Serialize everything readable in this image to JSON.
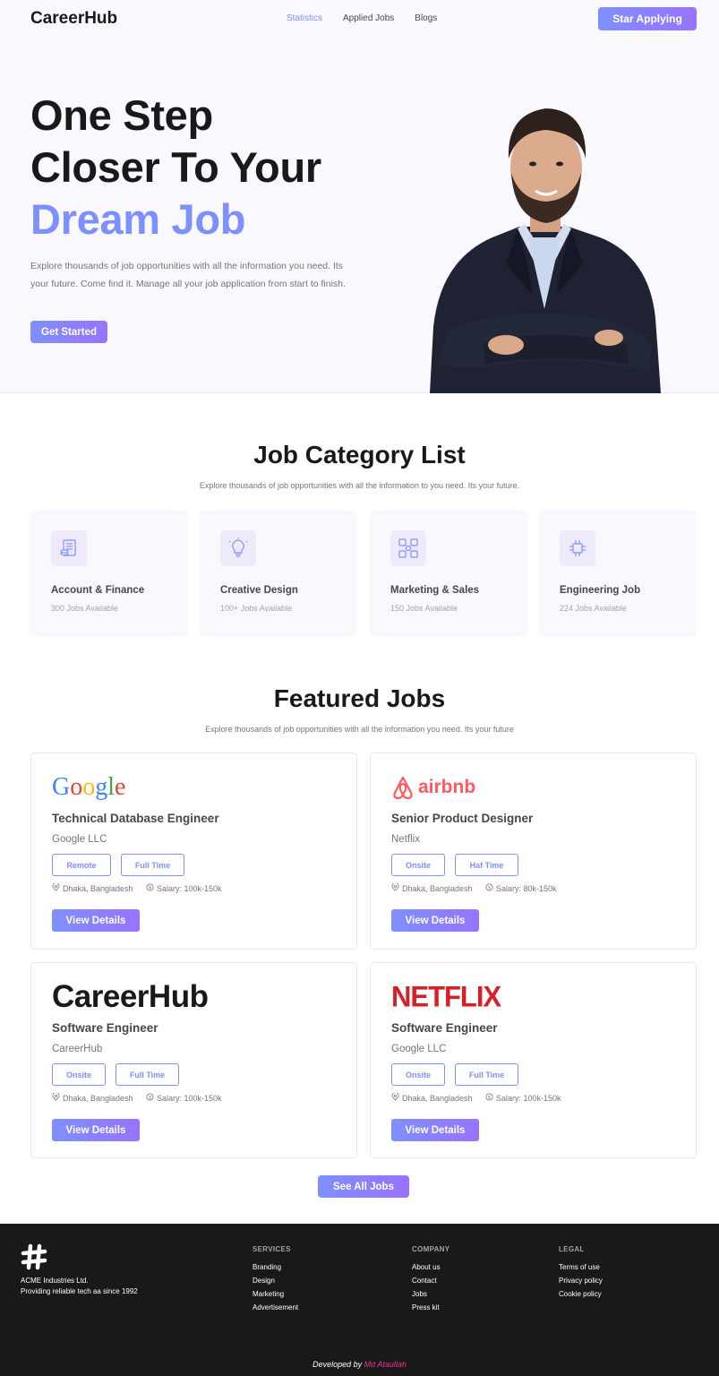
{
  "header": {
    "brand": "CareerHub",
    "nav": [
      "Statistics",
      "Applied Jobs",
      "Blogs"
    ],
    "cta": "Star Applying"
  },
  "hero": {
    "title_line1": "One Step",
    "title_line2": "Closer To Your",
    "title_accent": "Dream Job",
    "description": "Explore thousands of job opportunities with all the information you need. Its your future. Come find it. Manage all your job application from start to finish.",
    "cta": "Get Started"
  },
  "categories": {
    "title": "Job Category List",
    "subtitle": "Explore thousands of job opportunities with all the information to you need. Its your future.",
    "items": [
      {
        "title": "Account & Finance",
        "count": "300 Jobs Available",
        "icon": "finance-icon"
      },
      {
        "title": "Creative Design",
        "count": "100+ Jobs Available",
        "icon": "lightbulb-icon"
      },
      {
        "title": "Marketing & Sales",
        "count": "150 Jobs Available",
        "icon": "marketing-icon"
      },
      {
        "title": "Engineering Job",
        "count": "224 Jobs Available",
        "icon": "chip-icon"
      }
    ]
  },
  "featured": {
    "title": "Featured Jobs",
    "subtitle": "Explore thousands of job opportunities with all the information you need. Its your future",
    "jobs": [
      {
        "logo": "Google",
        "title": "Technical Database Engineer",
        "company": "Google LLC",
        "tag1": "Remote",
        "tag2": "Full Time",
        "location": "Dhaka, Bangladesh",
        "salary": "Salary: 100k-150k",
        "button": "View Details"
      },
      {
        "logo": "airbnb",
        "title": "Senior Product Designer",
        "company": "Netflix",
        "tag1": "Onsite",
        "tag2": "Haf Time",
        "location": "Dhaka, Bangladesh",
        "salary": "Salary: 80k-150k",
        "button": "View Details"
      },
      {
        "logo": "CareerHub",
        "title": "Software Engineer",
        "company": "CareerHub",
        "tag1": "Onsite",
        "tag2": "Full Time",
        "location": "Dhaka, Bangladesh",
        "salary": "Salary: 100k-150k",
        "button": "View Details"
      },
      {
        "logo": "NETFLIX",
        "title": "Software Engineer",
        "company": "Google LLC",
        "tag1": "Onsite",
        "tag2": "Full Time",
        "location": "Dhaka, Bangladesh",
        "salary": "Salary: 100k-150k",
        "button": "View Details"
      }
    ],
    "see_all": "See All Jobs"
  },
  "footer": {
    "company_line1": "ACME Industries Ltd.",
    "company_line2": "Providing reliable tech aa since 1992",
    "services": {
      "heading": "SERVICES",
      "links": [
        "Branding",
        "Design",
        "Marketing",
        "Advertisement"
      ]
    },
    "company": {
      "heading": "COMPANY",
      "links": [
        "About us",
        "Contact",
        "Jobs",
        "Press kit"
      ]
    },
    "legal": {
      "heading": "LEGAL",
      "links": [
        "Terms of use",
        "Privacy policy",
        "Cookie policy"
      ]
    },
    "credit_prefix": "Developed by",
    "credit_author": "Md Ataullah"
  },
  "colors": {
    "accent": "#7e90fe",
    "accent2": "#9873ff",
    "dark": "#1a1919",
    "credit": "#e7358d"
  }
}
